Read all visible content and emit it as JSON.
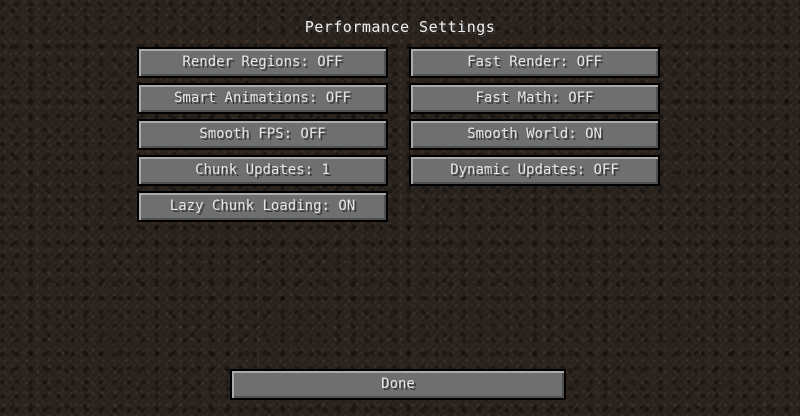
{
  "screen": {
    "title": "Performance Settings"
  },
  "options": {
    "left": [
      {
        "label": "Render Regions: OFF"
      },
      {
        "label": "Smart Animations: OFF"
      },
      {
        "label": "Smooth FPS: OFF"
      },
      {
        "label": "Chunk Updates: 1"
      },
      {
        "label": "Lazy Chunk Loading: ON"
      }
    ],
    "right": [
      {
        "label": "Fast Render: OFF"
      },
      {
        "label": "Fast Math: OFF"
      },
      {
        "label": "Smooth World: ON"
      },
      {
        "label": "Dynamic Updates: OFF"
      }
    ]
  },
  "footer": {
    "done_label": "Done"
  }
}
